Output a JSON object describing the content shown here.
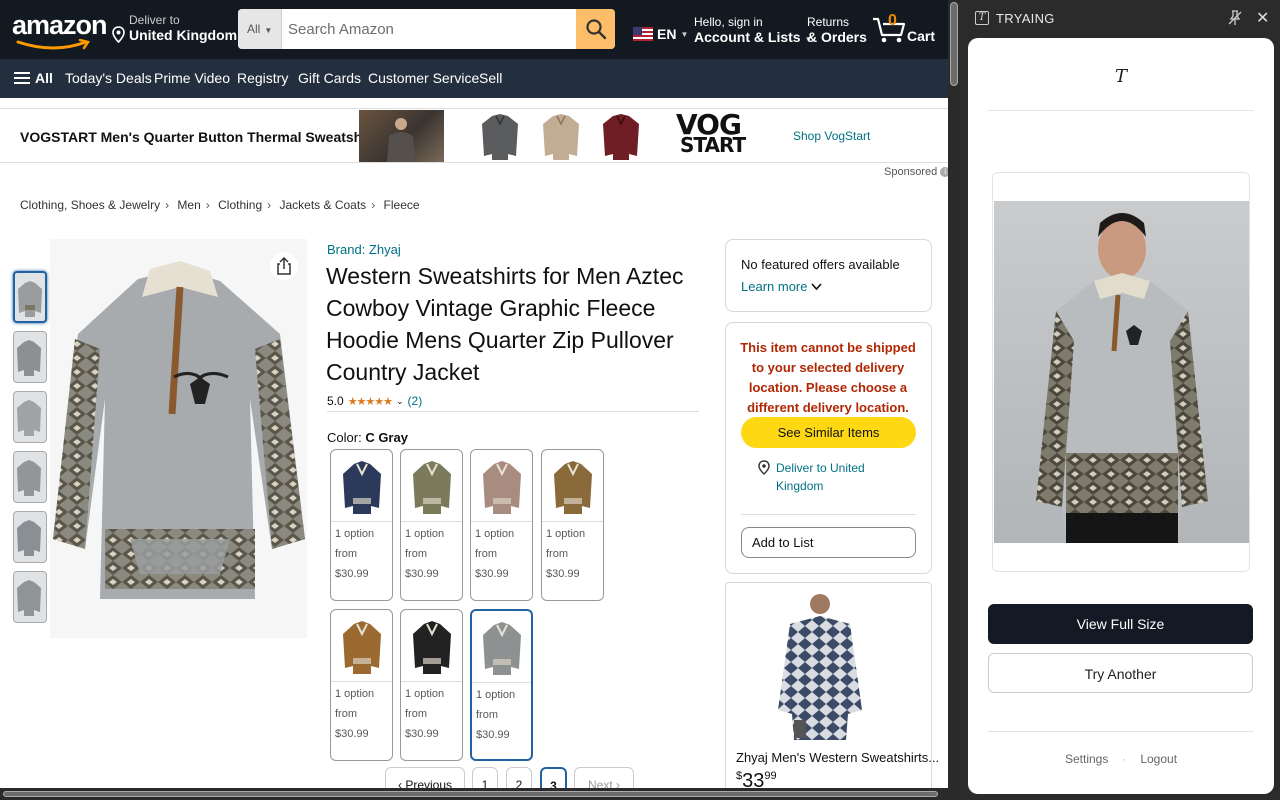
{
  "header": {
    "logo_text": "amazon",
    "deliver_line1": "Deliver to",
    "deliver_line2": "United Kingdom",
    "search_category": "All",
    "search_placeholder": "Search Amazon",
    "lang": "EN",
    "account_line1": "Hello, sign in",
    "account_line2": "Account & Lists",
    "returns_line1": "Returns",
    "returns_line2": "& Orders",
    "cart_count": "0",
    "cart_label": "Cart",
    "brand_color": "#131921",
    "accent": "#febd69"
  },
  "nav": {
    "all": "All",
    "items": [
      "Today's Deals",
      "Prime Video",
      "Registry",
      "Gift Cards",
      "Customer Service",
      "Sell"
    ]
  },
  "sponsor": {
    "title": "VOGSTART Men's Quarter Button Thermal Sweatshirt",
    "brand_logo_line1": "VOG",
    "brand_logo_line2": "START",
    "shop_link": "Shop VogStart",
    "sponsored_label": "Sponsored"
  },
  "breadcrumb": [
    "Clothing, Shoes & Jewelry",
    "Men",
    "Clothing",
    "Jackets & Coats",
    "Fleece"
  ],
  "product": {
    "brand": "Brand: Zhyaj",
    "title": "Western Sweatshirts for Men Aztec Cowboy Vintage Graphic Fleece Hoodie Mens Quarter Zip Pullover Country Jacket",
    "rating": "5.0",
    "stars": "★★★★★",
    "rating_count": "(2)",
    "color_label": "Color:",
    "color_value": "C Gray",
    "swatches": [
      {
        "line1": "1 option",
        "line2": "from",
        "price": "$30.99",
        "color": "#2b3a5a"
      },
      {
        "line1": "1 option",
        "line2": "from",
        "price": "$30.99",
        "color": "#7b7a5a"
      },
      {
        "line1": "1 option",
        "line2": "from",
        "price": "$30.99",
        "color": "#a88c80"
      },
      {
        "line1": "1 option",
        "line2": "from",
        "price": "$30.99",
        "color": "#8a6a3a"
      },
      {
        "line1": "1 option",
        "line2": "from",
        "price": "$30.99",
        "color": "#9a6a30"
      },
      {
        "line1": "1 option",
        "line2": "from",
        "price": "$30.99",
        "color": "#222222"
      },
      {
        "line1": "1 option",
        "line2": "from",
        "price": "$30.99",
        "color": "#8d9192"
      }
    ],
    "pager": {
      "prev": "‹ Previous",
      "pages": [
        "1",
        "2",
        "3"
      ],
      "next": "Next ›"
    }
  },
  "buybox": {
    "no_offers": "No featured offers available",
    "learn_more": "Learn more",
    "warning": "This item cannot be shipped to your selected delivery location. Please choose a different delivery location.",
    "similar_btn": "See Similar Items",
    "deliver_to": "Deliver to United Kingdom",
    "add_to_list": "Add to List",
    "rec_title": "Zhyaj Men's Western Sweatshirts...",
    "rec_price_symbol": "$",
    "rec_price_whole": "33",
    "rec_price_frac": "99"
  },
  "extension": {
    "title": "TRYAING",
    "logo": "T",
    "view_btn": "View Full Size",
    "try_btn": "Try Another",
    "settings": "Settings",
    "separator": "·",
    "logout": "Logout"
  }
}
